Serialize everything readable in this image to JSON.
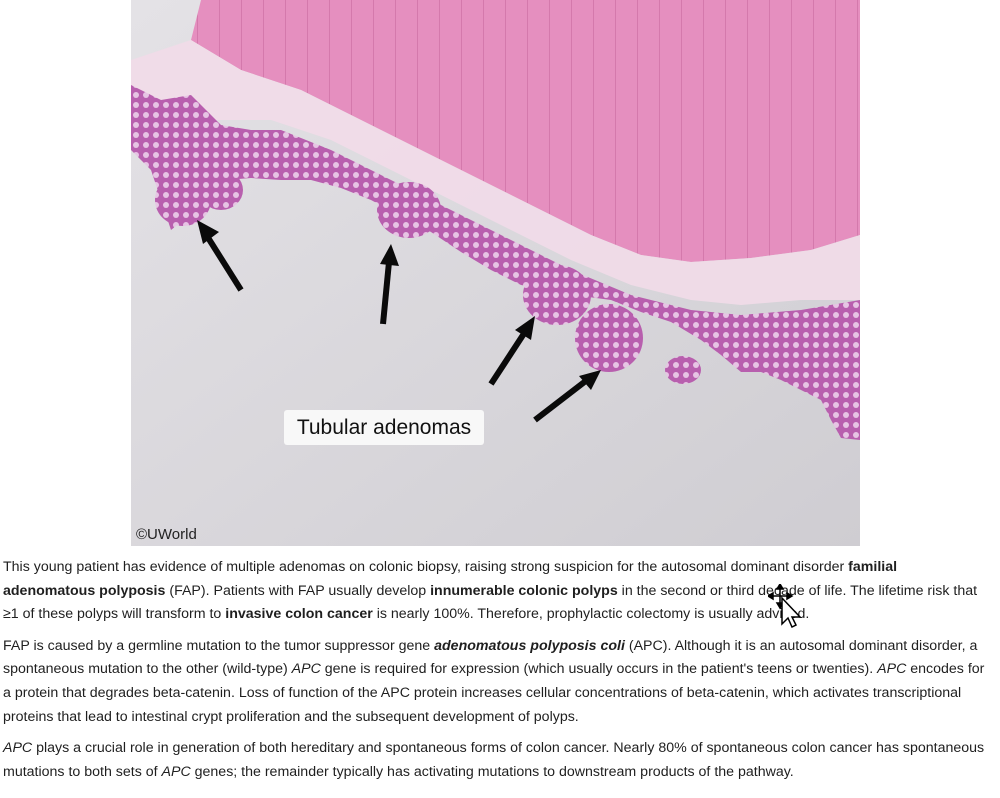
{
  "figure": {
    "label": "Tubular adenomas",
    "copyright": "©UWorld"
  },
  "paragraphs": [
    [
      {
        "t": "This young patient has evidence of multiple adenomas on colonic biopsy, raising strong suspicion for the autosomal dominant disorder "
      },
      {
        "t": "familial adenomatous polyposis",
        "b": true
      },
      {
        "t": " (FAP).  Patients with FAP usually develop "
      },
      {
        "t": "innumerable colonic polyps",
        "b": true
      },
      {
        "t": " in the second or third decade of life.  The lifetime risk that ≥1 of these polyps will transform to "
      },
      {
        "t": "invasive colon cancer",
        "b": true
      },
      {
        "t": " is nearly 100%.  Therefore, prophylactic colectomy is usually advised."
      }
    ],
    [
      {
        "t": "FAP is caused by a germline mutation to the tumor suppressor gene "
      },
      {
        "t": "adenomatous polyposis coli",
        "b": true,
        "i": true
      },
      {
        "t": " (APC).  Although it is an autosomal dominant disorder, a spontaneous mutation to the other (wild-type) "
      },
      {
        "t": "APC",
        "i": true
      },
      {
        "t": " gene is required for expression (which usually occurs in the patient's teens or twenties).  "
      },
      {
        "t": "APC",
        "i": true
      },
      {
        "t": " encodes for a protein that degrades beta-catenin.  Loss of function of the APC protein increases cellular concentrations of beta-catenin, which activates transcriptional proteins that lead to intestinal crypt proliferation and the subsequent development of polyps."
      }
    ],
    [
      {
        "t": "APC",
        "i": true
      },
      {
        "t": " plays a crucial role in generation of both hereditary and spontaneous forms of colon cancer.  Nearly 80% of spontaneous colon cancer has spontaneous mutations to both sets of "
      },
      {
        "t": "APC",
        "i": true
      },
      {
        "t": " genes; the remainder typically has activating mutations to downstream products of the pathway."
      }
    ]
  ]
}
